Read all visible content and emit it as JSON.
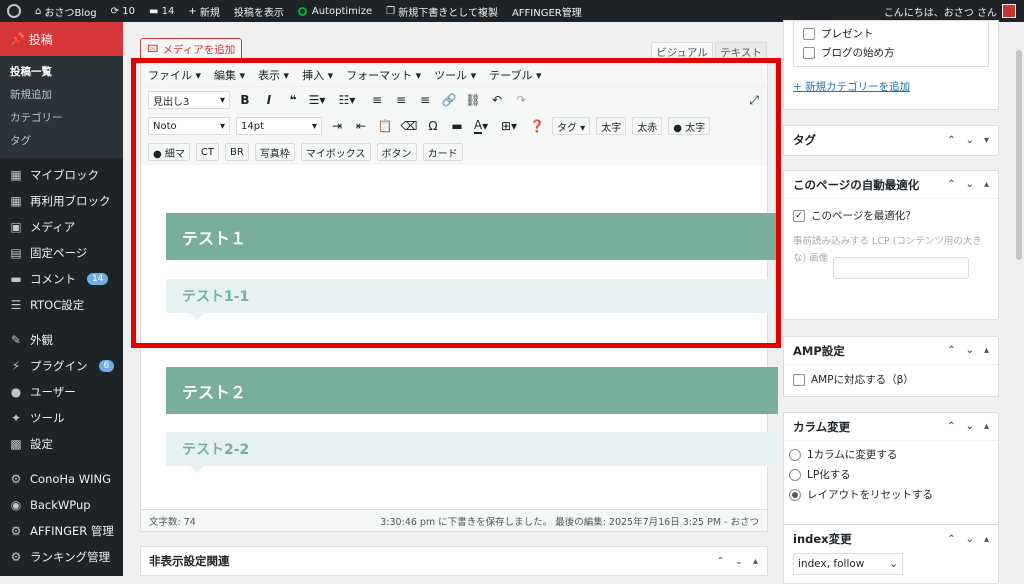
{
  "admin_bar": {
    "site_name": "おさつBlog",
    "updates_count": "10",
    "comments_count": "14",
    "new_label": "新規",
    "view_post": "投稿を表示",
    "autoptimize": "Autoptimize",
    "copy_draft": "新規下書きとして複製",
    "affinger": "AFFINGER管理",
    "greeting": "こんにちは、おさつ さん"
  },
  "sidebar": {
    "active": "投稿",
    "sub_items": [
      "投稿一覧",
      "新規追加",
      "カテゴリー",
      "タグ"
    ],
    "items": [
      {
        "label": "マイブロック",
        "icon": "▦"
      },
      {
        "label": "再利用ブロック",
        "icon": "▦"
      },
      {
        "label": "メディア",
        "icon": "▣"
      },
      {
        "label": "固定ページ",
        "icon": "▤"
      },
      {
        "label": "コメント",
        "icon": "▬",
        "badge": "14"
      },
      {
        "label": "RTOC設定",
        "icon": "☰"
      }
    ],
    "items2": [
      {
        "label": "外観",
        "icon": "✎"
      },
      {
        "label": "プラグイン",
        "icon": "⚡",
        "badge": "6"
      },
      {
        "label": "ユーザー",
        "icon": "●"
      },
      {
        "label": "ツール",
        "icon": "✦"
      },
      {
        "label": "設定",
        "icon": "▩"
      }
    ],
    "items3": [
      {
        "label": "ConoHa WING",
        "icon": "⚙"
      },
      {
        "label": "BackWPup",
        "icon": "◉"
      },
      {
        "label": "AFFINGER 管理",
        "icon": "⚙"
      },
      {
        "label": "ランキング管理",
        "icon": "⚙"
      }
    ]
  },
  "editor": {
    "add_media": "メディアを追加",
    "tab_visual": "ビジュアル",
    "tab_text": "テキスト",
    "menu": [
      "ファイル ▾",
      "編集 ▾",
      "表示 ▾",
      "挿入 ▾",
      "フォーマット ▾",
      "ツール ▾",
      "テーブル ▾"
    ],
    "format_select": "見出し3",
    "font_select": "Noto",
    "size_select": "14pt",
    "row2_buttons": [
      "タグ ▾",
      "太字",
      "太赤",
      "● 太字"
    ],
    "row3_buttons": [
      "● 細マ",
      "CT",
      "BR",
      "写真枠",
      "マイボックス",
      "ボタン",
      "カード"
    ],
    "content": {
      "h2_1": "テスト１",
      "h3_1": "テスト1-1",
      "h2_2": "テスト２",
      "h3_2": "テスト2-2"
    },
    "word_count": "文字数: 74",
    "save_status": "3:30:46 pm に下書きを保存しました。 最後の編集: 2025年7月16日 3:25 PM - おさつ"
  },
  "hidden_settings": "非表示設定関連",
  "side": {
    "categories": [
      "プレゼント",
      "ブログの始め方"
    ],
    "add_category": "+ 新規カテゴリーを追加",
    "tag_title": "タグ",
    "auto_opt_title": "このページの自動最適化",
    "auto_opt_check": "このページを最適化？",
    "lcp_text": "事前読み込みする LCP (コンテンツ用の大きな) 画像",
    "amp_title": "AMP設定",
    "amp_check": "AMPに対応する（β）",
    "column_title": "カラム変更",
    "column_options": [
      "1カラムに変更する",
      "LP化する",
      "レイアウトをリセットする"
    ],
    "index_title": "index変更",
    "index_select": "index, follow"
  }
}
